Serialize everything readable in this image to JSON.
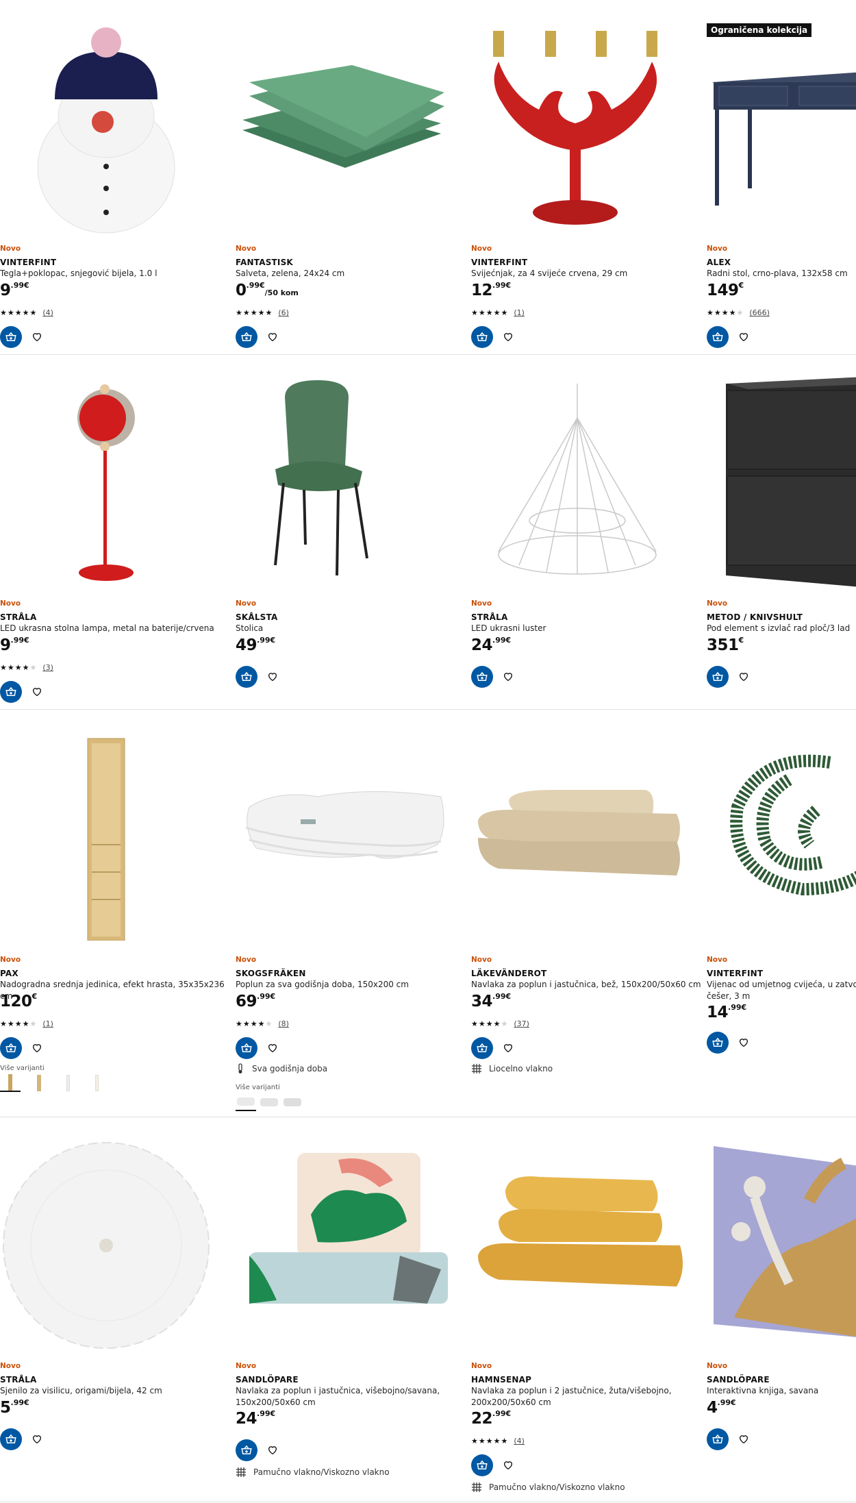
{
  "labels": {
    "new": "Novo",
    "more_variants": "Više varijanti",
    "limited": "Ograničena kolekcija"
  },
  "products": [
    {
      "name": "VINTERFINT",
      "desc": "Tegla+poklopac, snjegović bijela, 1.0 l",
      "price_int": "9",
      "price_dec": ".99€",
      "unit": "",
      "rating": 5,
      "reviews": "(4)"
    },
    {
      "name": "FANTASTISK",
      "desc": "Salveta, zelena, 24x24 cm",
      "price_int": "0",
      "price_dec": ".99€",
      "unit": "/50 kom",
      "rating": 5,
      "reviews": "(6)"
    },
    {
      "name": "VINTERFINT",
      "desc": "Svijećnjak, za 4 svijeće crvena, 29 cm",
      "price_int": "12",
      "price_dec": ".99€",
      "unit": "",
      "rating": 5,
      "reviews": "(1)"
    },
    {
      "name": "ALEX",
      "desc": "Radni stol, crno-plava, 132x58 cm",
      "price_int": "149",
      "price_dec": "€",
      "unit": "",
      "rating": 4.5,
      "reviews": "(666)"
    },
    {
      "name": "STRÅLA",
      "desc": "LED ukrasna stolna lampa, metal na baterije/crvena",
      "price_int": "9",
      "price_dec": ".99€",
      "unit": "",
      "rating": 4,
      "reviews": "(3)"
    },
    {
      "name": "SKÅLSTA",
      "desc": "Stolica",
      "price_int": "49",
      "price_dec": ".99€",
      "unit": ""
    },
    {
      "name": "STRÅLA",
      "desc": "LED ukrasni luster",
      "price_int": "24",
      "price_dec": ".99€",
      "unit": ""
    },
    {
      "name": "METOD / KNIVSHULT",
      "desc": "Pod element s izvlač rad ploč/3 lad",
      "price_int": "351",
      "price_dec": "€",
      "unit": ""
    },
    {
      "name": "PAX",
      "desc": "Nadogradna srednja jedinica, efekt hrasta, 35x35x236 cm",
      "price_int": "120",
      "price_dec": "€",
      "unit": "",
      "rating": 4,
      "reviews": "(1)"
    },
    {
      "name": "SKOGSFRÄKEN",
      "desc": "Poplun za sva godišnja doba, 150x200 cm",
      "price_int": "69",
      "price_dec": ".99€",
      "unit": "",
      "rating": 4.5,
      "reviews": "(8)",
      "feature": "Sva godišnja doba"
    },
    {
      "name": "LÄKEVÄNDEROT",
      "desc": "Navlaka za poplun i jastučnica, bež, 150x200/50x60 cm",
      "price_int": "34",
      "price_dec": ".99€",
      "unit": "",
      "rating": 4,
      "reviews": "(37)",
      "feature": "Liocelno vlakno"
    },
    {
      "name": "VINTERFINT",
      "desc": "Vijenac od umjetnog cvijeća, u zatvorenom/vanjski bor/",
      "desc2": "češer, 3 m",
      "price_int": "14",
      "price_dec": ".99€",
      "unit": ""
    },
    {
      "name": "STRÅLA",
      "desc": "Sjenilo za visilicu, origami/bijela, 42 cm",
      "price_int": "5",
      "price_dec": ".99€",
      "unit": ""
    },
    {
      "name": "SANDLÖPARE",
      "desc": "Navlaka za poplun i jastučnica, višebojno/savana,",
      "desc2": "150x200/50x60 cm",
      "price_int": "24",
      "price_dec": ".99€",
      "unit": "",
      "feature": "Pamučno vlakno/Viskozno vlakno"
    },
    {
      "name": "HAMNSENAP",
      "desc": "Navlaka za poplun i 2 jastučnice, žuta/višebojno,",
      "desc2": "200x200/50x60 cm",
      "price_int": "22",
      "price_dec": ".99€",
      "unit": "",
      "rating": 5,
      "reviews": "(4)",
      "feature": "Pamučno vlakno/Viskozno vlakno"
    },
    {
      "name": "SANDLÖPARE",
      "desc": "Interaktivna knjiga, savana",
      "price_int": "4",
      "price_dec": ".99€",
      "unit": ""
    }
  ],
  "colors": {
    "accent_blue": "#0058a3",
    "new_orange": "#ca5008"
  },
  "icons": {
    "cart": "add-to-cart-icon",
    "fav": "heart-icon",
    "feature_season": "thermometer-icon",
    "feature_fabric": "fabric-icon"
  }
}
